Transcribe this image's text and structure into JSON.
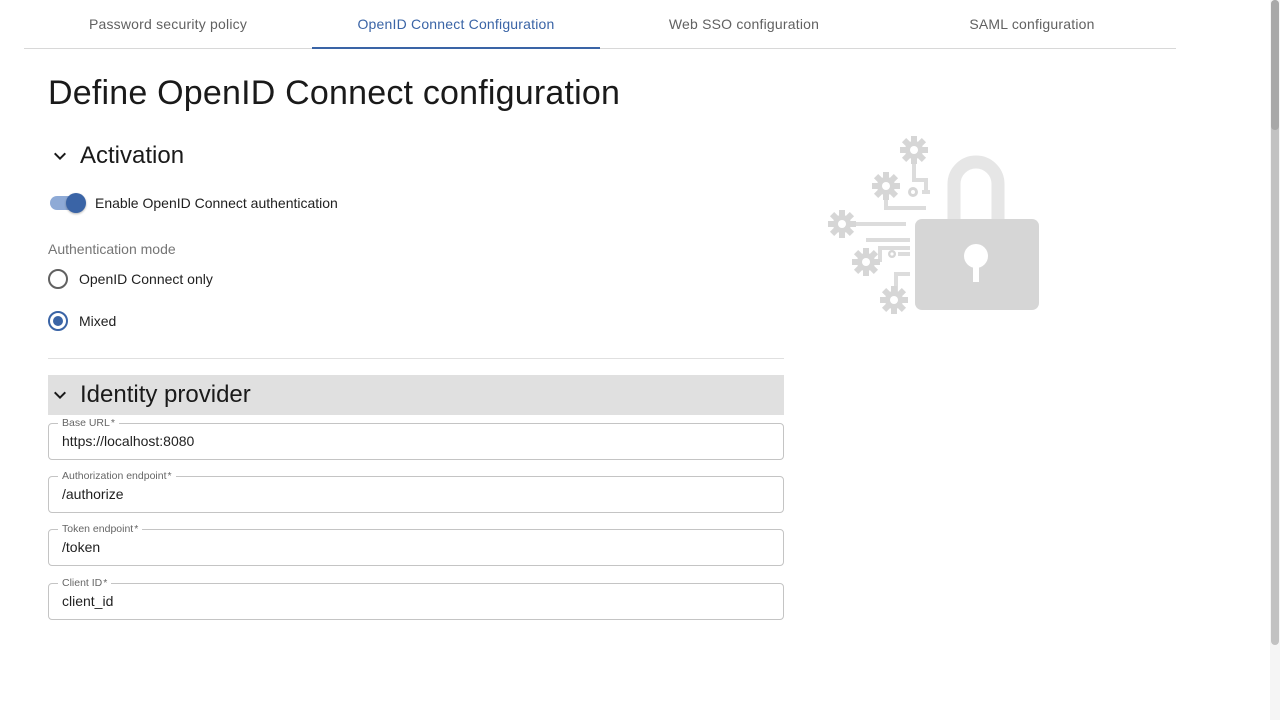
{
  "tabs": [
    {
      "label": "Password security policy",
      "active": false
    },
    {
      "label": "OpenID Connect Configuration",
      "active": true
    },
    {
      "label": "Web SSO configuration",
      "active": false
    },
    {
      "label": "SAML configuration",
      "active": false
    }
  ],
  "page_title": "Define OpenID Connect configuration",
  "activation": {
    "title": "Activation",
    "toggle_label": "Enable OpenID Connect authentication",
    "toggle_on": true,
    "mode_label": "Authentication mode",
    "modes": [
      {
        "label": "OpenID Connect only",
        "checked": false
      },
      {
        "label": "Mixed",
        "checked": true
      }
    ]
  },
  "identity_provider": {
    "title": "Identity provider",
    "fields": [
      {
        "label": "Base URL",
        "required": "*",
        "value": "https://localhost:8080"
      },
      {
        "label": "Authorization endpoint",
        "required": "*",
        "value": "/authorize"
      },
      {
        "label": "Token endpoint",
        "required": "*",
        "value": "/token"
      },
      {
        "label": "Client ID",
        "required": "*",
        "value": "client_id"
      }
    ]
  },
  "icons": {
    "section_chevron": "chevron-down-icon",
    "illustration": "padlock-gears-illustration"
  },
  "colors": {
    "accent": "#3a64a6",
    "toggle_track": "#8eaad6",
    "section_header_bg": "#e0e0e0",
    "illustration": "#d6d6d6"
  }
}
